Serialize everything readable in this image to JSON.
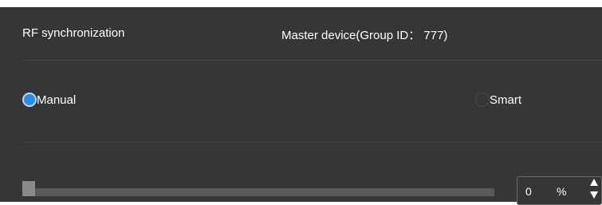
{
  "header": {
    "title": "RF synchronization",
    "master_info": "Master device(Group ID： 777)"
  },
  "mode": {
    "options": [
      {
        "label": "Manual",
        "checked": true
      },
      {
        "label": "Smart",
        "checked": false
      }
    ]
  },
  "level": {
    "value": "0",
    "unit": "%",
    "fraction": 0
  },
  "colors": {
    "panel_bg": "#363636",
    "accent": "#2c8ce8",
    "text": "#ffffff"
  },
  "icons": {
    "spin_up": "triangle-up",
    "spin_down": "triangle-down"
  }
}
